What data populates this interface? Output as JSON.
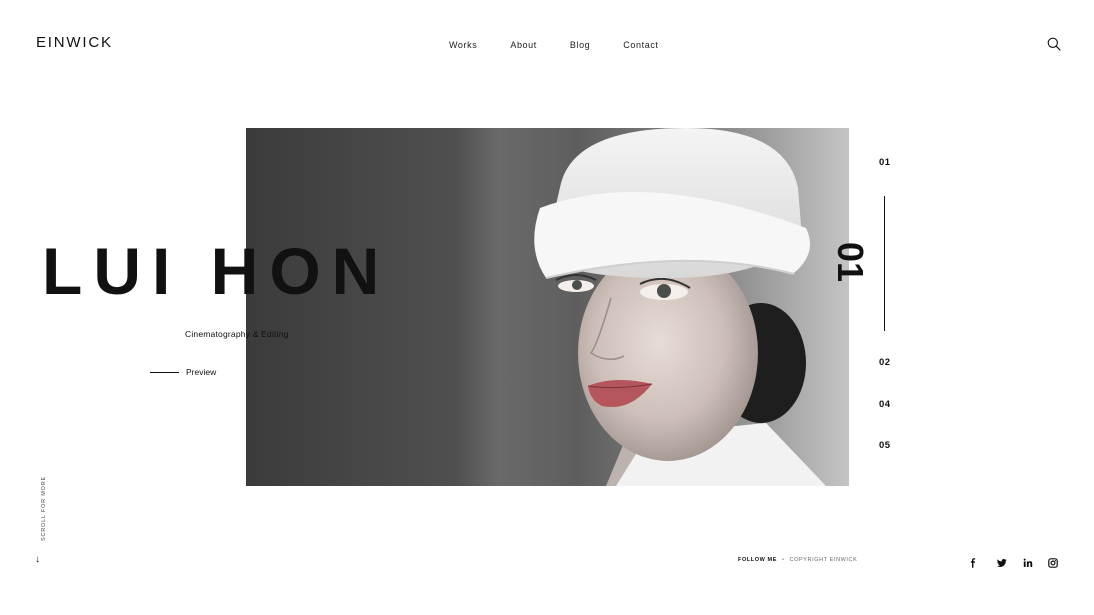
{
  "header": {
    "logo": "EINWICK",
    "nav": [
      "Works",
      "About",
      "Blog",
      "Contact"
    ],
    "search_icon": "search-icon"
  },
  "hero": {
    "title": "LUI HON",
    "subtitle": "Cinematography & Editing",
    "preview_label": "Preview",
    "current_number": "01",
    "image": "portrait-woman-white-hat"
  },
  "slides": {
    "items": [
      "01",
      "02",
      "04",
      "05"
    ],
    "active": "01"
  },
  "scroll": {
    "label": "SCROLL FOR MORE",
    "arrow": "↓"
  },
  "footer": {
    "follow": "FOLLOW ME",
    "separator": "•",
    "copyright": "COPYRIGHT EINWICK",
    "socials": [
      "facebook-icon",
      "twitter-icon",
      "linkedin-icon",
      "instagram-icon"
    ]
  }
}
